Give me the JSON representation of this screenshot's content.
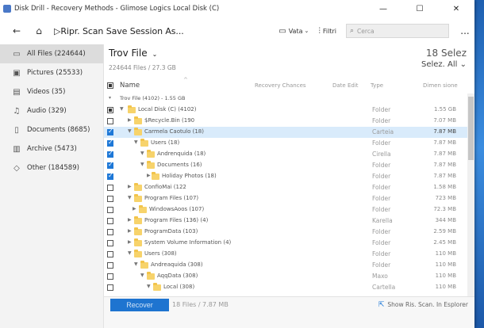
{
  "window": {
    "title": "Disk Drill - Recovery Methods - Glimose Logics Local Disk (C)",
    "minimize": "—",
    "maximize": "☐",
    "close": "✕"
  },
  "toolbar": {
    "breadcrumb": "Ripr. Scan Save Session As...",
    "view_label": "Vata",
    "filter_label": "Filtri",
    "search_placeholder": "Cerca",
    "more": "..."
  },
  "sidebar": {
    "items": [
      {
        "label": "All Files (224644)",
        "icon": "files-icon",
        "glyph": "▭"
      },
      {
        "label": "Pictures (25533)",
        "icon": "picture-icon",
        "glyph": "▣"
      },
      {
        "label": "Videos (35)",
        "icon": "video-icon",
        "glyph": "▤"
      },
      {
        "label": "Audio (329)",
        "icon": "music-icon",
        "glyph": "♫"
      },
      {
        "label": "Documents (8685)",
        "icon": "document-icon",
        "glyph": "▯"
      },
      {
        "label": "Archive (5473)",
        "icon": "archive-icon",
        "glyph": "▥"
      },
      {
        "label": "Other (184589)",
        "icon": "other-icon",
        "glyph": "◇"
      }
    ]
  },
  "header": {
    "title": "Trov File",
    "subtitle": "224644 Files / 27.3 GB",
    "selected_count": "18 Selez",
    "select_all": "Selez. All"
  },
  "columns": {
    "name": "Name",
    "recovery": "Recovery Chances",
    "date": "Date Edit",
    "type": "Type",
    "size": "Dimen sione"
  },
  "rows": [
    {
      "label": "Trov File (4102) - 1.55 GB",
      "type": "",
      "size": ""
    },
    {
      "label": "Local Disk (C) (4102)",
      "type": "Folder",
      "size": "1.55 GB"
    },
    {
      "label": "$Recycle.Bin (190",
      "type": "Folder",
      "size": "7.07 MB"
    },
    {
      "label": "Carmela Caotulo (18)",
      "type": "Carteia",
      "size": "7.87 MB"
    },
    {
      "label": "Users (18)",
      "type": "Folder",
      "size": "7.87 MB"
    },
    {
      "label": "Andrenquida (18)",
      "type": "Cirella",
      "size": "7.87 MB"
    },
    {
      "label": "Documents (16)",
      "type": "Folder",
      "size": "7.87 MB"
    },
    {
      "label": "Holiday Photos (18)",
      "type": "Folder",
      "size": "7.87 MB"
    },
    {
      "label": "ConfioMai (122",
      "type": "Folder",
      "size": "1.58 MB"
    },
    {
      "label": "Program Files (107)",
      "type": "Folder",
      "size": "723 MB"
    },
    {
      "label": "WindowsAoos (107)",
      "type": "Folder",
      "size": "72.3 MB"
    },
    {
      "label": "Program Files (136) (4)",
      "type": "Karella",
      "size": "344 MB"
    },
    {
      "label": "ProgramData (103)",
      "type": "Folder",
      "size": "2.59 MB"
    },
    {
      "label": "System Volume Information (4)",
      "type": "Folder",
      "size": "2.45 MB"
    },
    {
      "label": "Users (308)",
      "type": "Folder",
      "size": "110 MB"
    },
    {
      "label": "Andreaquida (308)",
      "type": "Folder",
      "size": "110 MB"
    },
    {
      "label": "AqqData (308)",
      "type": "Maxo",
      "size": "110 MB"
    },
    {
      "label": "Local (308)",
      "type": "Cartella",
      "size": "110 MB"
    }
  ],
  "bottom": {
    "recover_label": "Recover",
    "files_selected": "18 Files / 7.87 MB",
    "export_label": "Show Ris. Scan. In Esplorer"
  },
  "colors": {
    "accent": "#1e78d7",
    "selected_row": "#d9ebfb",
    "folder": "#f7d36b"
  }
}
